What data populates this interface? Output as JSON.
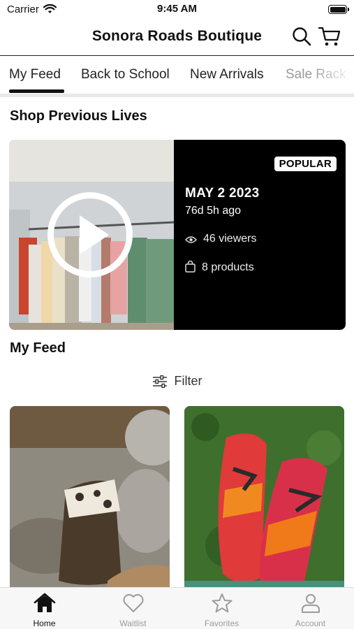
{
  "status_bar": {
    "carrier": "Carrier",
    "time": "9:45 AM"
  },
  "header": {
    "title": "Sonora Roads Boutique",
    "search_icon": "search-icon",
    "cart_icon": "cart-icon"
  },
  "tabs": [
    {
      "label": "My Feed",
      "active": true
    },
    {
      "label": "Back to School",
      "active": false
    },
    {
      "label": "New Arrivals",
      "active": false
    },
    {
      "label": "Sale Rack",
      "active": false
    }
  ],
  "previous_lives": {
    "title": "Shop Previous Lives",
    "card": {
      "badge": "POPULAR",
      "date": "MAY 2 2023",
      "ago": "76d 5h ago",
      "viewers": "46 viewers",
      "products": "8 products"
    }
  },
  "feed": {
    "title": "My Feed",
    "filter_label": "Filter",
    "products": [
      {
        "name": "sandal-product-image"
      },
      {
        "name": "flip-flop-product-image"
      }
    ]
  },
  "bottom_nav": [
    {
      "label": "Home",
      "icon": "home-icon",
      "active": true
    },
    {
      "label": "Waitlist",
      "icon": "heart-icon",
      "active": false
    },
    {
      "label": "Favorites",
      "icon": "star-icon",
      "active": false
    },
    {
      "label": "Account",
      "icon": "person-icon",
      "active": false
    }
  ]
}
